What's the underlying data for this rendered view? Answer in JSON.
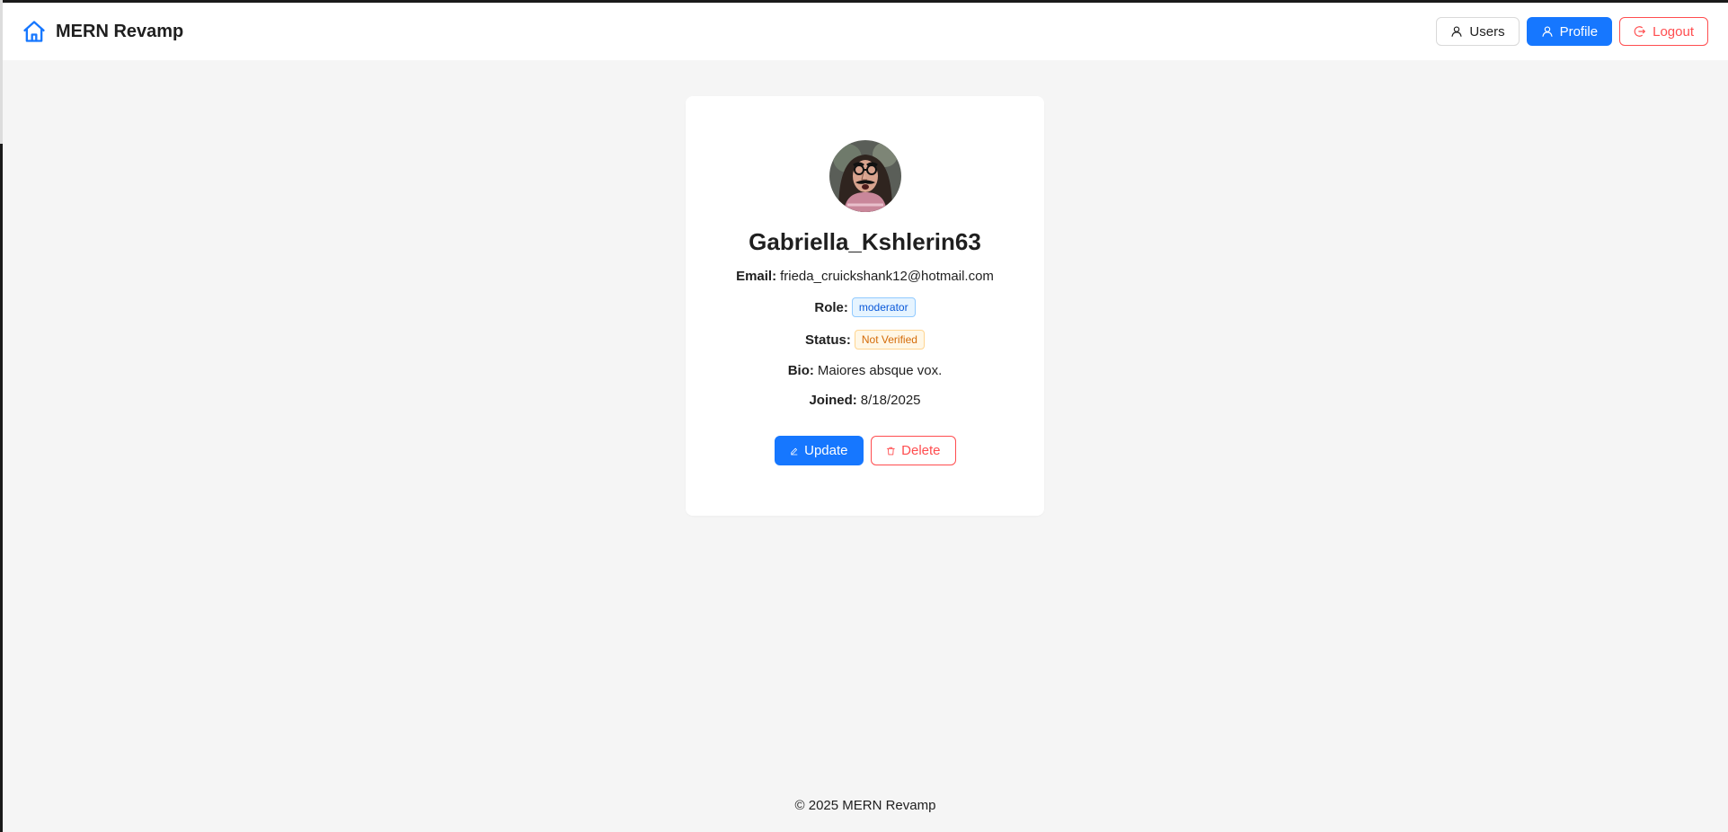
{
  "header": {
    "brand_title": "MERN Revamp",
    "nav": {
      "users_label": "Users",
      "profile_label": "Profile",
      "logout_label": "Logout"
    }
  },
  "profile": {
    "username": "Gabriella_Kshlerin63",
    "email_label": "Email:",
    "email": "frieda_cruickshank12@hotmail.com",
    "role_label": "Role:",
    "role": "moderator",
    "status_label": "Status:",
    "status": "Not Verified",
    "bio_label": "Bio:",
    "bio": "Maiores absque vox.",
    "joined_label": "Joined:",
    "joined": "8/18/2025",
    "update_label": "Update",
    "delete_label": "Delete"
  },
  "footer": {
    "copyright": "© 2025 MERN Revamp"
  },
  "colors": {
    "primary": "#1677ff",
    "danger": "#ff4d4f",
    "role_tag": "#0958d9",
    "status_tag": "#d46b08",
    "background": "#f5f5f5"
  },
  "icons": {
    "brand": "home-icon",
    "users": "user-icon",
    "profile": "user-icon",
    "logout": "logout-icon",
    "update": "edit-icon",
    "delete": "trash-icon"
  }
}
